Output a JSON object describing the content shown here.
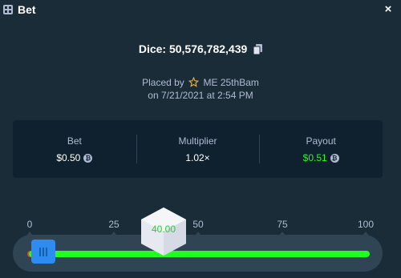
{
  "window": {
    "title": "Bet",
    "icon": "dice-grid-icon",
    "close_label": "×"
  },
  "bet": {
    "game_id": "Dice: 50,576,782,439",
    "placed_by_prefix": "Placed by",
    "user": "ME 25thBam",
    "date": "on 7/21/2021 at 2:54 PM"
  },
  "stats": [
    {
      "label": "Bet",
      "value": "$0.50",
      "coin": true
    },
    {
      "label": "Multiplier",
      "value": "1.02×",
      "coin": false
    },
    {
      "label": "Payout",
      "value": "$0.51",
      "coin": true
    }
  ],
  "slider": {
    "ticks": [
      "0",
      "25",
      "50",
      "75",
      "100"
    ],
    "roll_result": "40.00",
    "threshold_value": 2
  },
  "colors": {
    "background": "#1a2c38",
    "panel": "#0f212e",
    "win_green": "#1fff20",
    "lose_red": "#ff2f53",
    "handle_blue": "#2e8cf0"
  }
}
